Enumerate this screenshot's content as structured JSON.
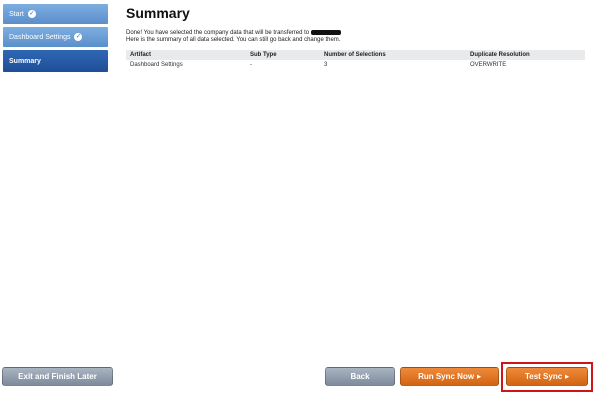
{
  "steps": [
    {
      "label": "Start",
      "completed": true,
      "icon": "check-circle-icon"
    },
    {
      "label": "Dashboard Settings",
      "completed": true,
      "icon": "check-circle-icon"
    },
    {
      "label": "Summary",
      "completed": false,
      "active": true
    }
  ],
  "main": {
    "title": "Summary",
    "intro_line1": "Done! You have selected the company data that will be transferred to",
    "intro_line2": "Here is the summary of all data selected. You can still go back and change them."
  },
  "table": {
    "headers": [
      "Artifact",
      "Sub Type",
      "Number of Selections",
      "Duplicate Resolution"
    ],
    "rows": [
      [
        "Dashboard Settings",
        "-",
        "3",
        "OVERWRITE"
      ]
    ]
  },
  "buttons": {
    "exit": "Exit and Finish Later",
    "back": "Back",
    "run_sync": "Run Sync Now",
    "test_sync": "Test Sync"
  },
  "colors": {
    "step_inactive": "#5b8fcb",
    "step_active": "#1e4f97",
    "button_gray": "#7e8b9c",
    "button_orange": "#d26512",
    "highlight": "#d0141c"
  }
}
